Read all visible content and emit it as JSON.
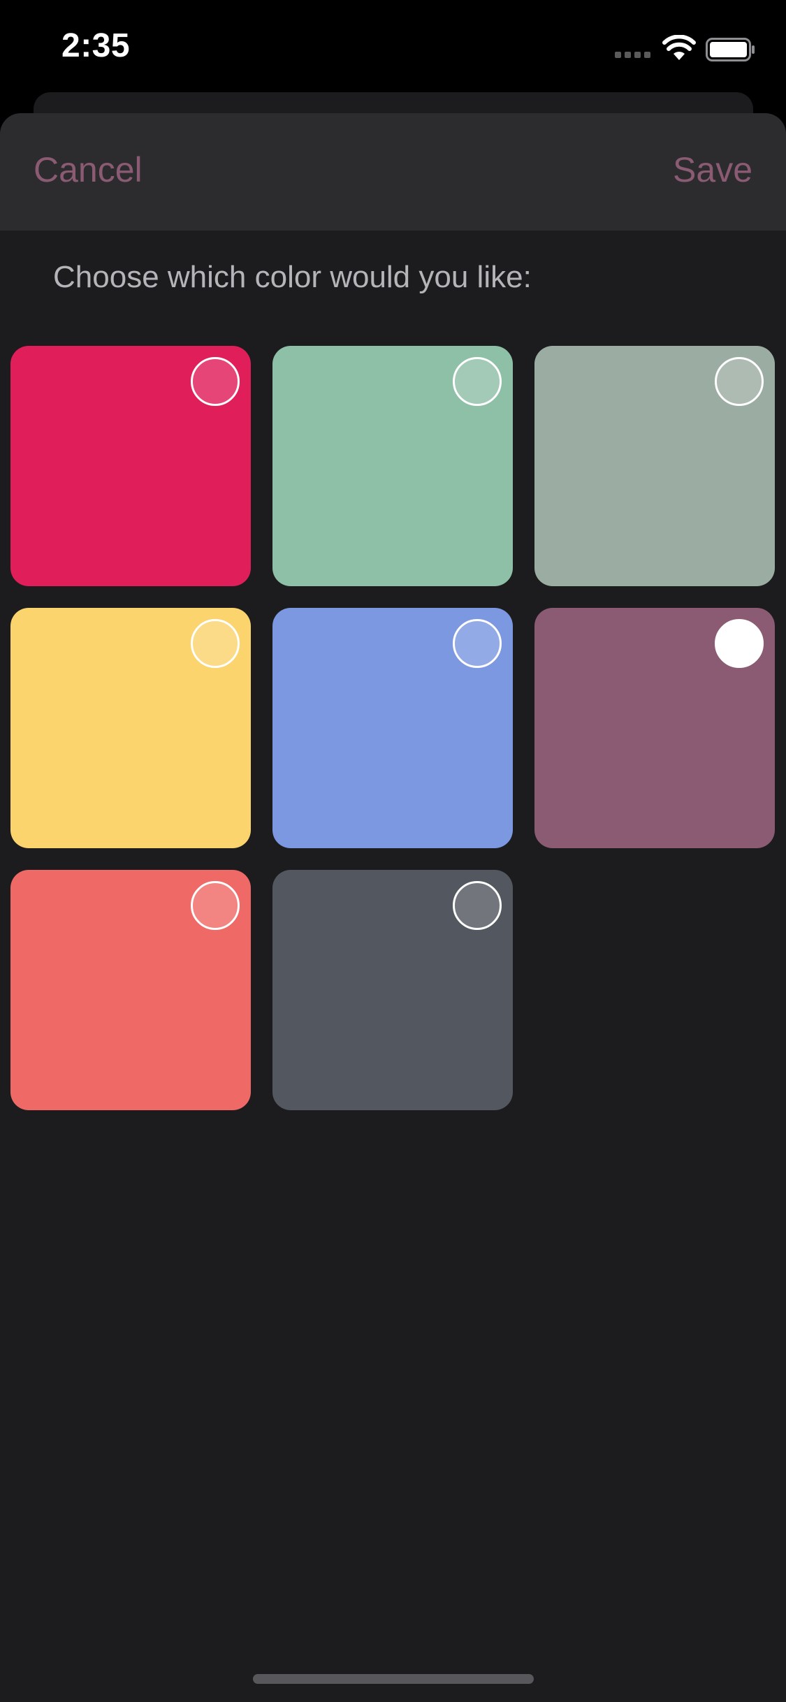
{
  "status_bar": {
    "time": "2:35",
    "icons": [
      "signal-icon",
      "wifi-icon",
      "battery-icon"
    ]
  },
  "nav": {
    "cancel_label": "Cancel",
    "save_label": "Save",
    "accent_color": "#8b5a73"
  },
  "prompt": "Choose which color would you like:",
  "swatches": [
    {
      "name": "crimson",
      "color": "#e01e5a",
      "selected": false
    },
    {
      "name": "mint",
      "color": "#8ebfa7",
      "selected": false
    },
    {
      "name": "sage-gray",
      "color": "#9bada2",
      "selected": false
    },
    {
      "name": "yellow",
      "color": "#fbd46d",
      "selected": false
    },
    {
      "name": "periwinkle",
      "color": "#7b98e0",
      "selected": false
    },
    {
      "name": "plum",
      "color": "#8b5a73",
      "selected": true
    },
    {
      "name": "coral",
      "color": "#ef6966",
      "selected": false
    },
    {
      "name": "slate",
      "color": "#535860",
      "selected": false
    }
  ],
  "theme": {
    "background": "#1c1c1e",
    "nav_background": "#2c2c2e",
    "prompt_color": "#b5b5b9"
  }
}
